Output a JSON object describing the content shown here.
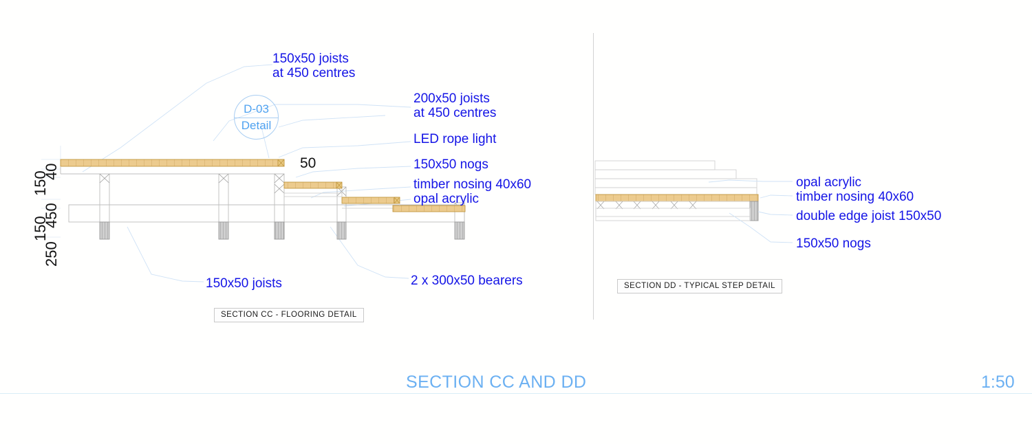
{
  "sheet": {
    "background": "#ffffff",
    "annotation_color": "#1414e6",
    "accent_color": "#6bb0f2",
    "timber_color": "#e8c982",
    "line_color": "#c9c9c9"
  },
  "footer": {
    "title": "SECTION CC AND DD",
    "scale": "1:50"
  },
  "section_cc": {
    "title": "SECTION CC - FLOORING DETAIL",
    "detail_bubble": {
      "ref": "D-03",
      "kind": "Detail"
    },
    "callouts": [
      {
        "text": "150x50 joists\nat 450 centres"
      },
      {
        "text": "200x50 joists\nat 450 centres"
      },
      {
        "text": "LED rope light"
      },
      {
        "text": "150x50 nogs"
      },
      {
        "text": "timber nosing 40x60\nopal acrylic"
      },
      {
        "text": "150x50 joists"
      },
      {
        "text": "2 x 300x50 bearers"
      }
    ],
    "dimensions_vertical": [
      "40",
      "150",
      "450",
      "150",
      "250"
    ],
    "dimensions_other": [
      "50"
    ]
  },
  "section_dd": {
    "title": "SECTION DD - TYPICAL STEP DETAIL",
    "callouts": [
      {
        "text": "opal acrylic\ntimber nosing 40x60"
      },
      {
        "text": "double edge joist 150x50"
      },
      {
        "text": "150x50 nogs"
      }
    ]
  }
}
